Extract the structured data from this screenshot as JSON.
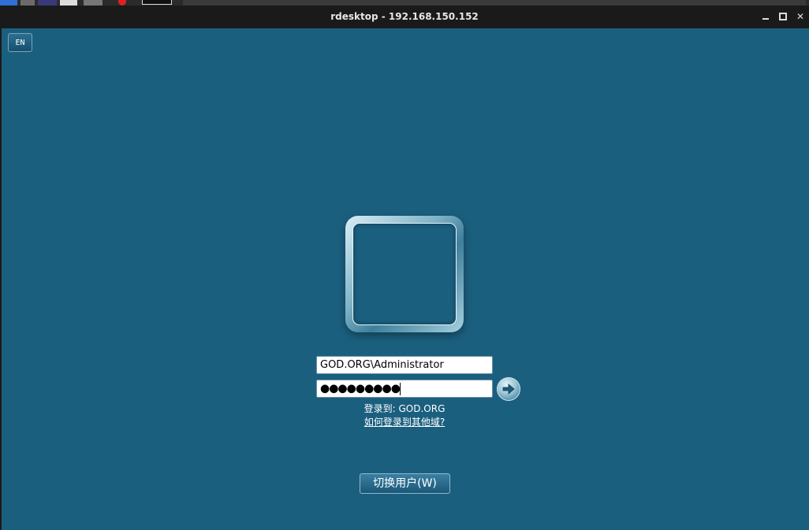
{
  "window": {
    "title": "rdesktop - 192.168.150.152"
  },
  "language": {
    "label": "EN"
  },
  "login": {
    "username_value": "GOD.ORG\\Administrator",
    "password_masked": "●●●●●●●●●",
    "logon_to": "登录到: GOD.ORG",
    "other_domain_link": "如何登录到其他域?",
    "switch_user_label": "切换用户(W)"
  },
  "colors": {
    "background": "#1b5f7e",
    "titlebar": "#1a1a1a"
  },
  "icons": {
    "submit": "arrow-right-icon",
    "minimize": "minimize-icon",
    "maximize": "maximize-icon",
    "close": "close-icon"
  }
}
